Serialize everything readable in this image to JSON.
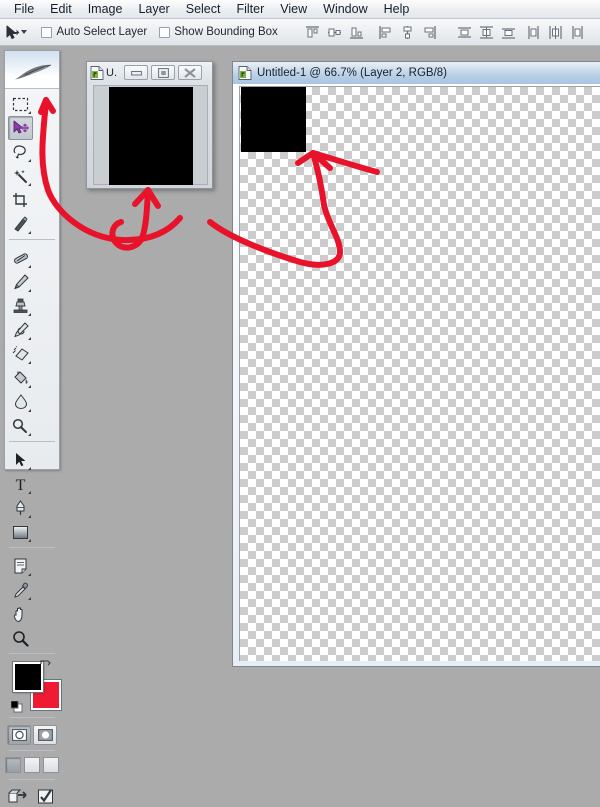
{
  "app": {
    "name": "Adobe Photoshop",
    "background_color": "#ababab"
  },
  "menubar": {
    "items": [
      {
        "label": "File"
      },
      {
        "label": "Edit"
      },
      {
        "label": "Image"
      },
      {
        "label": "Layer"
      },
      {
        "label": "Select"
      },
      {
        "label": "Filter"
      },
      {
        "label": "View"
      },
      {
        "label": "Window"
      },
      {
        "label": "Help"
      }
    ]
  },
  "optionsbar": {
    "active_tool_icon": "move-tool-icon",
    "tool_preset_dropdown": "chevron-down-icon",
    "checkboxes": [
      {
        "label": "Auto Select Layer",
        "checked": false
      },
      {
        "label": "Show Bounding Box",
        "checked": false
      }
    ],
    "align_group": [
      {
        "name": "align-top-edges-icon"
      },
      {
        "name": "align-vertical-centers-icon"
      },
      {
        "name": "align-bottom-edges-icon"
      }
    ],
    "align_group2": [
      {
        "name": "align-left-edges-icon"
      },
      {
        "name": "align-horizontal-centers-icon"
      },
      {
        "name": "align-right-edges-icon"
      }
    ],
    "distribute_group": [
      {
        "name": "distribute-top-edges-icon"
      },
      {
        "name": "distribute-vertical-centers-icon"
      },
      {
        "name": "distribute-bottom-edges-icon"
      }
    ],
    "distribute_group2": [
      {
        "name": "distribute-left-edges-icon"
      },
      {
        "name": "distribute-horizontal-centers-icon"
      },
      {
        "name": "distribute-right-edges-icon"
      }
    ]
  },
  "toolbox": {
    "header_icon": "feather-logo-icon",
    "tools_row1": [
      {
        "name": "marquee-tool",
        "selected": false,
        "has_submenu": true
      },
      {
        "name": "move-tool",
        "selected": true,
        "has_submenu": false
      }
    ],
    "tools_row2": [
      {
        "name": "lasso-tool",
        "selected": false,
        "has_submenu": true
      },
      {
        "name": "magic-wand-tool",
        "selected": false,
        "has_submenu": true
      }
    ],
    "tools_row3": [
      {
        "name": "crop-tool",
        "selected": false,
        "has_submenu": false
      },
      {
        "name": "slice-tool",
        "selected": false,
        "has_submenu": true
      }
    ],
    "tools_row4": [
      {
        "name": "healing-brush-tool",
        "selected": false,
        "has_submenu": true
      },
      {
        "name": "brush-tool",
        "selected": false,
        "has_submenu": true
      }
    ],
    "tools_row5": [
      {
        "name": "clone-stamp-tool",
        "selected": false,
        "has_submenu": true
      },
      {
        "name": "history-brush-tool",
        "selected": false,
        "has_submenu": true
      }
    ],
    "tools_row6": [
      {
        "name": "eraser-tool",
        "selected": false,
        "has_submenu": true
      },
      {
        "name": "paint-bucket-tool",
        "selected": false,
        "has_submenu": true
      }
    ],
    "tools_row7": [
      {
        "name": "blur-tool",
        "selected": false,
        "has_submenu": true
      },
      {
        "name": "dodge-tool",
        "selected": false,
        "has_submenu": true
      }
    ],
    "tools_row8": [
      {
        "name": "path-selection-tool",
        "selected": false,
        "has_submenu": true
      },
      {
        "name": "type-tool",
        "selected": false,
        "has_submenu": true
      }
    ],
    "tools_row9": [
      {
        "name": "pen-tool",
        "selected": false,
        "has_submenu": true
      },
      {
        "name": "shape-tool",
        "selected": false,
        "has_submenu": true
      }
    ],
    "tools_row10": [
      {
        "name": "notes-tool",
        "selected": false,
        "has_submenu": true
      },
      {
        "name": "eyedropper-tool",
        "selected": false,
        "has_submenu": true
      }
    ],
    "tools_row11": [
      {
        "name": "hand-tool",
        "selected": false,
        "has_submenu": false
      },
      {
        "name": "zoom-tool",
        "selected": false,
        "has_submenu": false
      }
    ],
    "colors": {
      "foreground": "#000000",
      "background": "#ee1b33",
      "swap_icon": "swap-colors-icon",
      "default_icon": "default-colors-icon"
    },
    "quickmask": [
      {
        "name": "standard-mode-button",
        "active": true
      },
      {
        "name": "quick-mask-mode-button",
        "active": false
      }
    ],
    "screenmodes": [
      {
        "name": "standard-screen-mode-button",
        "active": true
      },
      {
        "name": "full-screen-with-menubar-button",
        "active": false
      },
      {
        "name": "full-screen-mode-button",
        "active": false
      }
    ],
    "jumpto": [
      {
        "name": "jump-to-imageready-button"
      },
      {
        "name": "edit-in-imageready-button"
      }
    ]
  },
  "minidoc": {
    "icon": "photoshop-document-icon",
    "title": "U.",
    "buttons": [
      {
        "name": "minimize-button",
        "glyph": "minimize-icon"
      },
      {
        "name": "maximize-button",
        "glyph": "maximize-icon"
      },
      {
        "name": "close-button",
        "glyph": "close-icon"
      }
    ],
    "canvas_fill": "#000000"
  },
  "maindoc": {
    "icon": "photoshop-document-icon",
    "title": "Untitled-1 @ 66.7% (Layer 2, RGB/8)",
    "zoom": "66.7%",
    "document_name": "Untitled-1",
    "layer": "Layer 2",
    "color_mode": "RGB/8",
    "canvas_fill": "#000000",
    "transparency_checker": true
  },
  "annotation": {
    "color": "#e8132b",
    "stroke_width": 6,
    "arrows": [
      {
        "name": "arrow-to-move-tool",
        "description": "curved arrow from canvas area up to the Move tool in the toolbox"
      },
      {
        "name": "arrow-to-mini-document",
        "description": "curved arrow pointing up at the floating mini document window"
      },
      {
        "name": "arrow-to-main-canvas",
        "description": "curved arrow looping up to the black layer in the main document"
      }
    ]
  }
}
